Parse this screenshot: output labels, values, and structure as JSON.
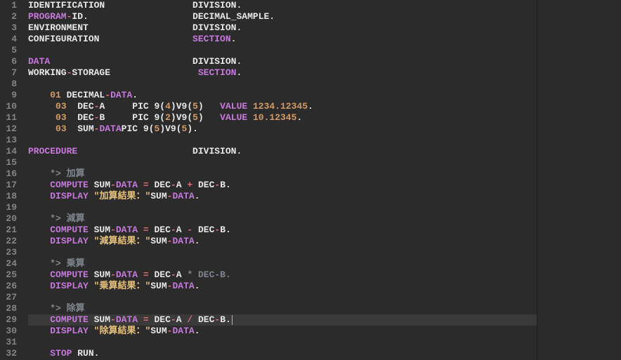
{
  "editor": {
    "highlighted_line": 29,
    "lines": [
      {
        "n": 1,
        "indent": 0,
        "tokens": [
          [
            "IDENTIFICATION",
            "tk-white",
            30
          ],
          [
            "DIVISION",
            "tk-white",
            0
          ],
          [
            ".",
            "tk-white",
            0
          ]
        ]
      },
      {
        "n": 2,
        "indent": 0,
        "tokens": [
          [
            "PROGRAM",
            "tk-purple",
            0
          ],
          [
            "-",
            "tk-red",
            0
          ],
          [
            "ID",
            "tk-white",
            0
          ],
          [
            ".",
            "tk-white",
            20
          ],
          [
            "DECIMAL_SAMPLE",
            "tk-white",
            0
          ],
          [
            ".",
            "tk-white",
            0
          ]
        ]
      },
      {
        "n": 3,
        "indent": 0,
        "tokens": [
          [
            "ENVIRONMENT",
            "tk-white",
            30
          ],
          [
            "DIVISION",
            "tk-white",
            0
          ],
          [
            ".",
            "tk-white",
            0
          ]
        ]
      },
      {
        "n": 4,
        "indent": 0,
        "tokens": [
          [
            "CONFIGURATION",
            "tk-white",
            30
          ],
          [
            "SECTION",
            "tk-purple",
            0
          ],
          [
            ".",
            "tk-white",
            0
          ]
        ]
      },
      {
        "n": 5,
        "indent": 0,
        "tokens": []
      },
      {
        "n": 6,
        "indent": 0,
        "tokens": [
          [
            "DATA",
            "tk-purple",
            30
          ],
          [
            "DIVISION",
            "tk-white",
            0
          ],
          [
            ".",
            "tk-white",
            0
          ]
        ]
      },
      {
        "n": 7,
        "indent": 0,
        "tokens": [
          [
            "WORKING",
            "tk-white",
            0
          ],
          [
            "-",
            "tk-red",
            0
          ],
          [
            "STORAGE",
            "tk-white",
            23
          ],
          [
            "SECTION",
            "tk-purple",
            0
          ],
          [
            ".",
            "tk-white",
            0
          ]
        ]
      },
      {
        "n": 8,
        "indent": 0,
        "tokens": []
      },
      {
        "n": 9,
        "indent": 1,
        "tokens": [
          [
            "    ",
            "",
            0
          ],
          [
            "01",
            "tk-orange",
            0
          ],
          [
            " DECIMAL",
            "tk-white",
            0
          ],
          [
            "-",
            "tk-red",
            0
          ],
          [
            "DATA",
            "tk-purple",
            0
          ],
          [
            ".",
            "tk-white",
            0
          ]
        ]
      },
      {
        "n": 10,
        "indent": 2,
        "tokens": [
          [
            "     ",
            "",
            0
          ],
          [
            "03",
            "tk-orange",
            0
          ],
          [
            "  DEC",
            "tk-white",
            0
          ],
          [
            "-",
            "tk-red",
            0
          ],
          [
            "A",
            "tk-white",
            6
          ],
          [
            "PIC",
            "tk-white",
            0
          ],
          [
            " 9",
            "tk-white",
            0
          ],
          [
            "(",
            "tk-white",
            0
          ],
          [
            "4",
            "tk-orange",
            0
          ],
          [
            ")",
            "tk-white",
            0
          ],
          [
            "V9",
            "tk-white",
            0
          ],
          [
            "(",
            "tk-white",
            0
          ],
          [
            "5",
            "tk-orange",
            0
          ],
          [
            ")",
            "tk-white",
            4
          ],
          [
            "VALUE",
            "tk-purple",
            0
          ],
          [
            " ",
            "",
            0
          ],
          [
            "1234.12345",
            "tk-orange",
            0
          ],
          [
            ".",
            "tk-white",
            0
          ]
        ]
      },
      {
        "n": 11,
        "indent": 2,
        "tokens": [
          [
            "     ",
            "",
            0
          ],
          [
            "03",
            "tk-orange",
            0
          ],
          [
            "  DEC",
            "tk-white",
            0
          ],
          [
            "-",
            "tk-red",
            0
          ],
          [
            "B",
            "tk-white",
            6
          ],
          [
            "PIC",
            "tk-white",
            0
          ],
          [
            " 9",
            "tk-white",
            0
          ],
          [
            "(",
            "tk-white",
            0
          ],
          [
            "2",
            "tk-orange",
            0
          ],
          [
            ")",
            "tk-white",
            0
          ],
          [
            "V9",
            "tk-white",
            0
          ],
          [
            "(",
            "tk-white",
            0
          ],
          [
            "5",
            "tk-orange",
            0
          ],
          [
            ")",
            "tk-white",
            4
          ],
          [
            "VALUE",
            "tk-purple",
            0
          ],
          [
            " ",
            "",
            0
          ],
          [
            "10.12345",
            "tk-orange",
            0
          ],
          [
            ".",
            "tk-white",
            0
          ]
        ]
      },
      {
        "n": 12,
        "indent": 2,
        "tokens": [
          [
            "     ",
            "",
            0
          ],
          [
            "03",
            "tk-orange",
            0
          ],
          [
            "  SUM",
            "tk-white",
            0
          ],
          [
            "-",
            "tk-red",
            0
          ],
          [
            "DATA",
            "tk-purple",
            3
          ],
          [
            "PIC",
            "tk-white",
            0
          ],
          [
            " 9",
            "tk-white",
            0
          ],
          [
            "(",
            "tk-white",
            0
          ],
          [
            "5",
            "tk-orange",
            0
          ],
          [
            ")",
            "tk-white",
            0
          ],
          [
            "V9",
            "tk-white",
            0
          ],
          [
            "(",
            "tk-white",
            0
          ],
          [
            "5",
            "tk-orange",
            0
          ],
          [
            ")",
            "tk-white",
            0
          ],
          [
            ".",
            "tk-white",
            0
          ]
        ]
      },
      {
        "n": 13,
        "indent": 0,
        "tokens": []
      },
      {
        "n": 14,
        "indent": 0,
        "tokens": [
          [
            "PROCEDURE",
            "tk-purple",
            30
          ],
          [
            "DIVISION",
            "tk-white",
            0
          ],
          [
            ".",
            "tk-white",
            0
          ]
        ]
      },
      {
        "n": 15,
        "indent": 0,
        "tokens": []
      },
      {
        "n": 16,
        "indent": 1,
        "tokens": [
          [
            "    *> 加算",
            "tk-comment",
            0
          ]
        ]
      },
      {
        "n": 17,
        "indent": 1,
        "tokens": [
          [
            "    ",
            "",
            0
          ],
          [
            "COMPUTE",
            "tk-purple",
            0
          ],
          [
            " SUM",
            "tk-white",
            0
          ],
          [
            "-",
            "tk-red",
            0
          ],
          [
            "DATA",
            "tk-purple",
            0
          ],
          [
            " ",
            "",
            0
          ],
          [
            "=",
            "tk-red",
            0
          ],
          [
            " DEC",
            "tk-white",
            0
          ],
          [
            "-",
            "tk-red",
            0
          ],
          [
            "A",
            "tk-white",
            0
          ],
          [
            " ",
            "",
            0
          ],
          [
            "+",
            "tk-red",
            0
          ],
          [
            " DEC",
            "tk-white",
            0
          ],
          [
            "-",
            "tk-red",
            0
          ],
          [
            "B",
            "tk-white",
            0
          ],
          [
            ".",
            "tk-white",
            0
          ]
        ]
      },
      {
        "n": 18,
        "indent": 1,
        "tokens": [
          [
            "    ",
            "",
            0
          ],
          [
            "DISPLAY",
            "tk-purple",
            0
          ],
          [
            " ",
            "",
            0
          ],
          [
            "\"加算結果：\"",
            "tk-yellow",
            0
          ],
          [
            "SUM",
            "tk-white",
            0
          ],
          [
            "-",
            "tk-red",
            0
          ],
          [
            "DATA",
            "tk-purple",
            0
          ],
          [
            ".",
            "tk-white",
            0
          ]
        ]
      },
      {
        "n": 19,
        "indent": 0,
        "tokens": []
      },
      {
        "n": 20,
        "indent": 1,
        "tokens": [
          [
            "    *> 減算",
            "tk-comment",
            0
          ]
        ]
      },
      {
        "n": 21,
        "indent": 1,
        "tokens": [
          [
            "    ",
            "",
            0
          ],
          [
            "COMPUTE",
            "tk-purple",
            0
          ],
          [
            " SUM",
            "tk-white",
            0
          ],
          [
            "-",
            "tk-red",
            0
          ],
          [
            "DATA",
            "tk-purple",
            0
          ],
          [
            " ",
            "",
            0
          ],
          [
            "=",
            "tk-red",
            0
          ],
          [
            " DEC",
            "tk-white",
            0
          ],
          [
            "-",
            "tk-red",
            0
          ],
          [
            "A",
            "tk-white",
            0
          ],
          [
            " ",
            "",
            0
          ],
          [
            "-",
            "tk-red",
            0
          ],
          [
            " DEC",
            "tk-white",
            0
          ],
          [
            "-",
            "tk-red",
            0
          ],
          [
            "B",
            "tk-white",
            0
          ],
          [
            ".",
            "tk-white",
            0
          ]
        ]
      },
      {
        "n": 22,
        "indent": 1,
        "tokens": [
          [
            "    ",
            "",
            0
          ],
          [
            "DISPLAY",
            "tk-purple",
            0
          ],
          [
            " ",
            "",
            0
          ],
          [
            "\"減算結果：\"",
            "tk-yellow",
            0
          ],
          [
            "SUM",
            "tk-white",
            0
          ],
          [
            "-",
            "tk-red",
            0
          ],
          [
            "DATA",
            "tk-purple",
            0
          ],
          [
            ".",
            "tk-white",
            0
          ]
        ]
      },
      {
        "n": 23,
        "indent": 0,
        "tokens": []
      },
      {
        "n": 24,
        "indent": 1,
        "tokens": [
          [
            "    *> 乗算",
            "tk-comment",
            0
          ]
        ]
      },
      {
        "n": 25,
        "indent": 1,
        "tokens": [
          [
            "    ",
            "",
            0
          ],
          [
            "COMPUTE",
            "tk-purple",
            0
          ],
          [
            " SUM",
            "tk-white",
            0
          ],
          [
            "-",
            "tk-red",
            0
          ],
          [
            "DATA",
            "tk-purple",
            0
          ],
          [
            " ",
            "",
            0
          ],
          [
            "=",
            "tk-red",
            0
          ],
          [
            " DEC",
            "tk-white",
            0
          ],
          [
            "-",
            "tk-red",
            0
          ],
          [
            "A",
            "tk-white",
            0
          ],
          [
            " ",
            "",
            0
          ],
          [
            "*",
            "tk-comment",
            0
          ],
          [
            " DEC-B.",
            "tk-comment",
            0
          ]
        ]
      },
      {
        "n": 26,
        "indent": 1,
        "tokens": [
          [
            "    ",
            "",
            0
          ],
          [
            "DISPLAY",
            "tk-purple",
            0
          ],
          [
            " ",
            "",
            0
          ],
          [
            "\"乗算結果：\"",
            "tk-yellow",
            0
          ],
          [
            "SUM",
            "tk-white",
            0
          ],
          [
            "-",
            "tk-red",
            0
          ],
          [
            "DATA",
            "tk-purple",
            0
          ],
          [
            ".",
            "tk-white",
            0
          ]
        ]
      },
      {
        "n": 27,
        "indent": 0,
        "tokens": []
      },
      {
        "n": 28,
        "indent": 1,
        "tokens": [
          [
            "    *> 除算",
            "tk-comment",
            0
          ]
        ]
      },
      {
        "n": 29,
        "indent": 1,
        "tokens": [
          [
            "    ",
            "",
            0
          ],
          [
            "COMPUTE",
            "tk-purple",
            0
          ],
          [
            " SUM",
            "tk-white",
            0
          ],
          [
            "-",
            "tk-red",
            0
          ],
          [
            "DATA",
            "tk-purple",
            0
          ],
          [
            " ",
            "",
            0
          ],
          [
            "=",
            "tk-red",
            0
          ],
          [
            " DEC",
            "tk-white",
            0
          ],
          [
            "-",
            "tk-red",
            0
          ],
          [
            "A",
            "tk-white",
            0
          ],
          [
            " ",
            "",
            0
          ],
          [
            "/",
            "tk-red",
            0
          ],
          [
            " DEC",
            "tk-white",
            0
          ],
          [
            "-",
            "tk-red",
            0
          ],
          [
            "B",
            "tk-white",
            0
          ],
          [
            ".",
            "tk-white",
            0
          ]
        ]
      },
      {
        "n": 30,
        "indent": 1,
        "tokens": [
          [
            "    ",
            "",
            0
          ],
          [
            "DISPLAY",
            "tk-purple",
            0
          ],
          [
            " ",
            "",
            0
          ],
          [
            "\"除算結果：\"",
            "tk-yellow",
            0
          ],
          [
            "SUM",
            "tk-white",
            0
          ],
          [
            "-",
            "tk-red",
            0
          ],
          [
            "DATA",
            "tk-purple",
            0
          ],
          [
            ".",
            "tk-white",
            0
          ]
        ]
      },
      {
        "n": 31,
        "indent": 0,
        "tokens": []
      },
      {
        "n": 32,
        "indent": 1,
        "tokens": [
          [
            "    ",
            "",
            0
          ],
          [
            "STOP",
            "tk-purple",
            0
          ],
          [
            " RUN",
            "tk-white",
            0
          ],
          [
            ".",
            "tk-white",
            0
          ]
        ]
      }
    ]
  }
}
